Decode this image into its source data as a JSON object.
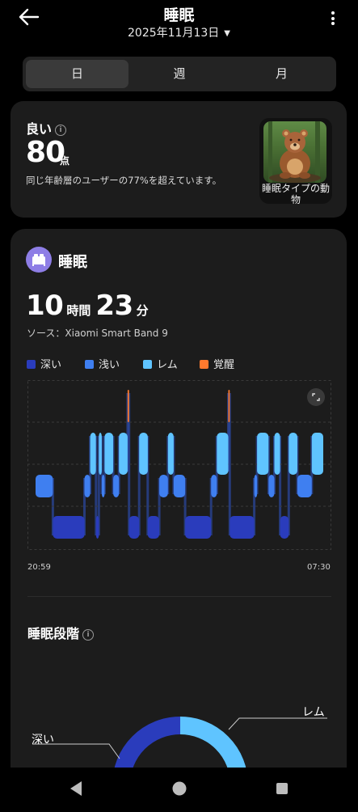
{
  "header": {
    "title": "睡眠",
    "date": "2025年11月13日"
  },
  "tabs": [
    {
      "label": "日",
      "active": true
    },
    {
      "label": "週",
      "active": false
    },
    {
      "label": "月",
      "active": false
    }
  ],
  "score_card": {
    "rating": "良い",
    "score": "80",
    "score_unit": "点",
    "description": "同じ年齢層のユーザーの77%を超えています。",
    "animal_label": "睡眠タイプの動物"
  },
  "sleep_card": {
    "title": "睡眠",
    "hours": "10",
    "hours_unit": "時間",
    "minutes": "23",
    "minutes_unit": "分",
    "source": "ソース：Xiaomi Smart Band 9",
    "legend": [
      {
        "label": "深い",
        "color": "#2a3cbc"
      },
      {
        "label": "浅い",
        "color": "#3f7ff0"
      },
      {
        "label": "レム",
        "color": "#5fc4ff"
      },
      {
        "label": "覚醒",
        "color": "#ff7a2e"
      }
    ],
    "start_time": "20:59",
    "end_time": "07:30",
    "stages_title": "睡眠段階",
    "stage_labels": {
      "deep": "深い",
      "rem": "レム"
    }
  },
  "chart_data": {
    "type": "bar",
    "stages": [
      "覚醒",
      "レム",
      "浅い",
      "深い"
    ],
    "x_start": "20:59",
    "x_end": "07:30",
    "segments": [
      {
        "stage": "浅い",
        "start": 0.0,
        "end": 0.06
      },
      {
        "stage": "深い",
        "start": 0.06,
        "end": 0.17
      },
      {
        "stage": "浅い",
        "start": 0.17,
        "end": 0.19
      },
      {
        "stage": "レム",
        "start": 0.19,
        "end": 0.21
      },
      {
        "stage": "深い",
        "start": 0.21,
        "end": 0.22
      },
      {
        "stage": "レム",
        "start": 0.22,
        "end": 0.23
      },
      {
        "stage": "浅い",
        "start": 0.23,
        "end": 0.24
      },
      {
        "stage": "レム",
        "start": 0.24,
        "end": 0.27
      },
      {
        "stage": "浅い",
        "start": 0.27,
        "end": 0.29
      },
      {
        "stage": "レム",
        "start": 0.29,
        "end": 0.32
      },
      {
        "stage": "覚醒",
        "start": 0.32,
        "end": 0.325
      },
      {
        "stage": "深い",
        "start": 0.325,
        "end": 0.36
      },
      {
        "stage": "レム",
        "start": 0.36,
        "end": 0.39
      },
      {
        "stage": "深い",
        "start": 0.39,
        "end": 0.43
      },
      {
        "stage": "浅い",
        "start": 0.43,
        "end": 0.46
      },
      {
        "stage": "レム",
        "start": 0.46,
        "end": 0.48
      },
      {
        "stage": "浅い",
        "start": 0.48,
        "end": 0.52
      },
      {
        "stage": "深い",
        "start": 0.52,
        "end": 0.61
      },
      {
        "stage": "浅い",
        "start": 0.61,
        "end": 0.63
      },
      {
        "stage": "レム",
        "start": 0.63,
        "end": 0.67
      },
      {
        "stage": "覚醒",
        "start": 0.67,
        "end": 0.675
      },
      {
        "stage": "深い",
        "start": 0.675,
        "end": 0.76
      },
      {
        "stage": "浅い",
        "start": 0.76,
        "end": 0.77
      },
      {
        "stage": "レム",
        "start": 0.77,
        "end": 0.81
      },
      {
        "stage": "浅い",
        "start": 0.81,
        "end": 0.83
      },
      {
        "stage": "レム",
        "start": 0.83,
        "end": 0.85
      },
      {
        "stage": "深い",
        "start": 0.85,
        "end": 0.88
      },
      {
        "stage": "レム",
        "start": 0.88,
        "end": 0.91
      },
      {
        "stage": "浅い",
        "start": 0.91,
        "end": 0.96
      },
      {
        "stage": "レム",
        "start": 0.96,
        "end": 1.0
      }
    ]
  }
}
